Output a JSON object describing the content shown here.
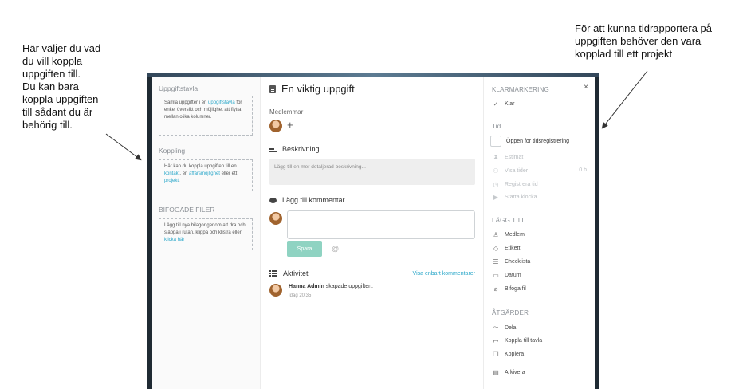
{
  "annotations": {
    "left_lines": [
      "Här väljer du vad",
      "du vill koppla",
      "uppgiften till.",
      "Du kan bara",
      "koppla uppgiften",
      "till sådant du är",
      "behörig till."
    ],
    "right_lines": [
      "För att kunna tidrapportera på",
      "uppgiften behöver den vara",
      "kopplad till ett projekt"
    ]
  },
  "left": {
    "board_title": "Uppgiftstavla",
    "board_box": {
      "pre": "Samla uppgifter i en ",
      "link": "uppgiftstavla",
      "post": " för enkel översikt och möjlighet att flytta mellan olika kolumner."
    },
    "connect_title": "Koppling",
    "connect_box": {
      "pre": "Här kan du koppla uppgiften till en ",
      "link1": "kontakt",
      "mid": ", en ",
      "link2": "affärsmöjlighet",
      "mid2": " eller ett ",
      "link3": "projekt",
      "post": "."
    },
    "files_title": "BIFOGADE FILER",
    "files_box": {
      "pre": "Lägg till nya bilagor genom att dra och släppa i rutan, klippa och klistra eller ",
      "link": "klicka här"
    }
  },
  "middle": {
    "title": "En viktig uppgift",
    "members_label": "Medlemmar",
    "plus": "+",
    "description_header": "Beskrivning",
    "description_placeholder": "Lägg till en mer detaljerad beskrivning...",
    "comment_header": "Lägg till kommentar",
    "save_label": "Spara",
    "at_symbol": "@",
    "activity_header": "Aktivitet",
    "activity_link": "Visa enbart kommentarer",
    "activity_user": "Hanna Admin",
    "activity_text": " skapade uppgiften.",
    "activity_time": "Idag 20:35"
  },
  "right": {
    "close": "×",
    "done_title": "KLARMARKERING",
    "done_item": "Klar",
    "time_title": "Tid",
    "open_time_reg": "Öppen för tidsregistrering",
    "estimate": "Estimat",
    "show_times": "Visa tider",
    "hours": "0 h",
    "register_time": "Registrera tid",
    "start_clock": "Starta klocka",
    "add_title": "LÄGG TILL",
    "add_member": "Medlem",
    "add_label": "Etikett",
    "add_checklist": "Checklista",
    "add_date": "Datum",
    "add_attach": "Bifoga fil",
    "actions_title": "ÅTGÄRDER",
    "share": "Dela",
    "connect_board": "Koppla till tavla",
    "copy": "Kopiera",
    "archive": "Arkivera"
  },
  "icons": {
    "check": "check-icon",
    "close": "close-icon",
    "hourglass": "hourglass-icon",
    "clock": "clock-icon",
    "play": "play-icon"
  }
}
